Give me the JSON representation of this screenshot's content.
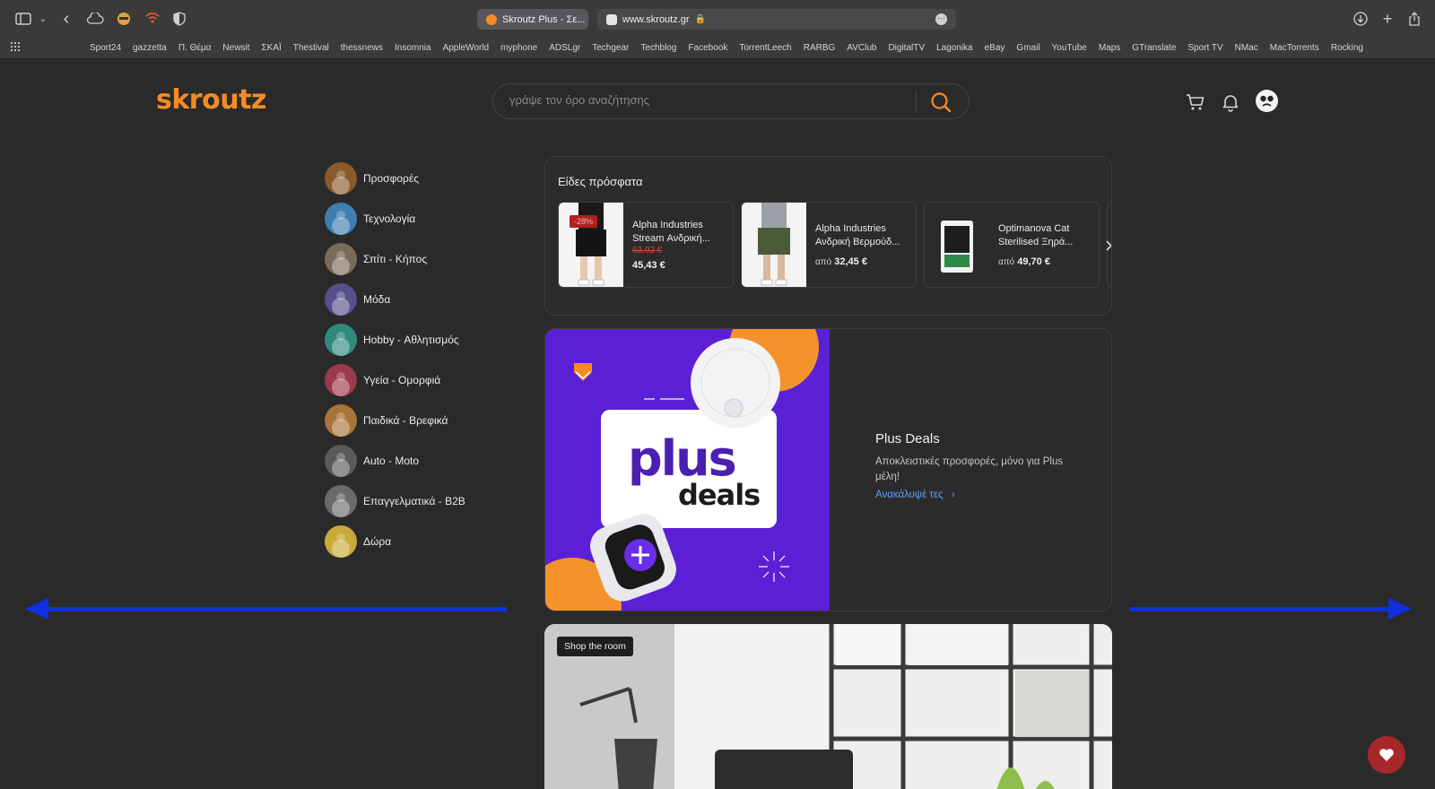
{
  "browser": {
    "active_tab_label": "Skroutz Plus - Σε...",
    "url": "www.skroutz.gr",
    "bookmarks": [
      "Sport24",
      "gazzetta",
      "Π. Θέμα",
      "Newsit",
      "ΣΚΑΪ",
      "Thestival",
      "thessnews",
      "Insomnia",
      "AppleWorld",
      "myphone",
      "ADSLgr",
      "Techgear",
      "Techblog",
      "Facebook",
      "TorrentLeech",
      "RARBG",
      "AVClub",
      "DigitalTV",
      "Lagonika",
      "eBay",
      "Gmail",
      "YouTube",
      "Maps",
      "GTranslate",
      "Sport TV",
      "NMac",
      "MacTorrents",
      "Rocking"
    ]
  },
  "header": {
    "logo": "skroutz",
    "search_placeholder": "γράψε τον όρο αναζήτησης"
  },
  "sidebar": {
    "items": [
      {
        "label": "Προσφορές",
        "icon": "deals-icon",
        "color": "#8a5a2b"
      },
      {
        "label": "Τεχνολογία",
        "icon": "technology-icon",
        "color": "#3f7fb0"
      },
      {
        "label": "Σπίτι - Κήπος",
        "icon": "home-garden-icon",
        "color": "#7a6a5a"
      },
      {
        "label": "Μόδα",
        "icon": "fashion-icon",
        "color": "#55508a"
      },
      {
        "label": "Hobby - Αθλητισμός",
        "icon": "sports-icon",
        "color": "#2f8a7e"
      },
      {
        "label": "Υγεία - Ομορφιά",
        "icon": "beauty-icon",
        "color": "#9a3a4a"
      },
      {
        "label": "Παιδικά - Βρεφικά",
        "icon": "kids-icon",
        "color": "#a8743a"
      },
      {
        "label": "Auto - Moto",
        "icon": "auto-icon",
        "color": "#5a5a5a"
      },
      {
        "label": "Επαγγελματικά - B2B",
        "icon": "b2b-icon",
        "color": "#6a6a6a"
      },
      {
        "label": "Δώρα",
        "icon": "gift-icon",
        "color": "#c9a93a"
      }
    ]
  },
  "recent": {
    "title": "Είδες πρόσφατα",
    "cards": [
      {
        "name": "Alpha Industries Stream Ανδρική...",
        "old_price": "63,92 €",
        "price": "45,43 €",
        "badge": "-28%",
        "from": ""
      },
      {
        "name": "Alpha Industries Ανδρική Βερμούδ...",
        "old_price": "",
        "price": "32,45 €",
        "badge": "",
        "from": "από"
      },
      {
        "name": "Optimanova Cat Sterilised Ξηρά...",
        "old_price": "",
        "price": "49,70 €",
        "badge": "",
        "from": "από"
      }
    ]
  },
  "plus_deals": {
    "art_line1": "plus",
    "art_line2": "deals",
    "title": "Plus Deals",
    "description": "Αποκλειστικές προσφορές, μόνο για Plus μέλη!",
    "link": "Ανακάλυψέ τες"
  },
  "room": {
    "label": "Shop the room"
  },
  "colors": {
    "brand": "#f68b24",
    "plus_purple": "#5b1fd6",
    "link_blue": "#5aa1ff",
    "arrow_blue": "#1030e0"
  }
}
